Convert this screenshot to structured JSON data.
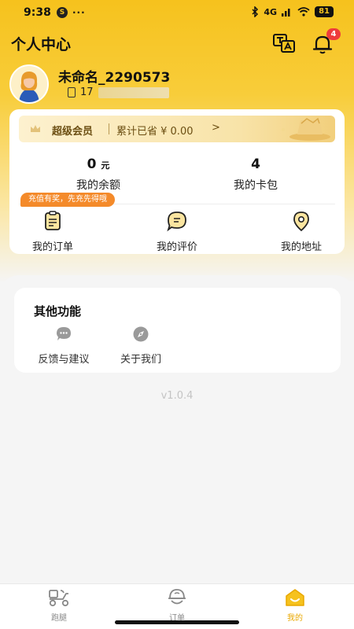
{
  "status_bar": {
    "time": "9:38",
    "notification_icon": "S",
    "more": "···",
    "network": "4G",
    "battery": "81"
  },
  "header": {
    "title": "个人中心",
    "notification_count": "4"
  },
  "profile": {
    "username": "未命名_2290573",
    "phone_prefix": "17"
  },
  "vip": {
    "label": "超级会员",
    "saved_text": "累计已省 ¥ 0.00",
    "arrow": ">"
  },
  "stats": [
    {
      "value": "0",
      "unit": "元",
      "label": "我的余额"
    },
    {
      "value": "4",
      "label": "我的卡包"
    }
  ],
  "promo_tag": "充值有奖，先充先得哦",
  "entries": [
    {
      "label": "我的订单",
      "icon": "order-list-icon"
    },
    {
      "label": "我的评价",
      "icon": "comment-icon"
    },
    {
      "label": "我的地址",
      "icon": "location-pin-icon"
    }
  ],
  "other": {
    "title": "其他功能",
    "items": [
      {
        "label": "反馈与建议",
        "icon": "chat-bubble-icon"
      },
      {
        "label": "关于我们",
        "icon": "compass-icon"
      }
    ]
  },
  "version": "v1.0.4",
  "bottom_nav": {
    "items": [
      {
        "label": "跑腿",
        "icon": "delivery-scooter-icon",
        "active": false
      },
      {
        "label": "订单",
        "icon": "order-icon",
        "active": false
      },
      {
        "label": "我的",
        "icon": "profile-home-icon",
        "active": true
      }
    ]
  },
  "colors": {
    "brand_yellow": "#f6c21d",
    "promo_orange": "#f48a2a",
    "badge_red": "#ee3c3c",
    "active_nav": "#e9a800"
  }
}
